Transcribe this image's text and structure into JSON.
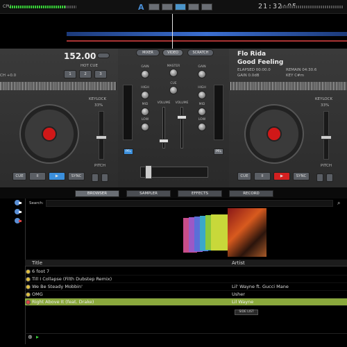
{
  "topbar": {
    "cpu_label": "CPU",
    "clock": "21:32:05",
    "logo": "A"
  },
  "deck_left": {
    "bpm": "152.00",
    "hot_cue_label": "HOT CUE",
    "hot_cues": [
      "1",
      "2",
      "3"
    ],
    "pitch_info": "CH +0.0",
    "keylock_label": "KEYLOCK",
    "pitch_pct": "33%",
    "pitch_label": "PITCH",
    "transport": [
      "CUE",
      "II",
      "▶",
      "SYNC"
    ]
  },
  "deck_right": {
    "artist": "Flo Rida",
    "title": "Good Feeling",
    "elapsed": "ELAPSED 00:00.0",
    "remain": "REMAIN 04:30.6",
    "gain": "GAIN 0.0dB",
    "key": "KEY C#m",
    "keylock_label": "KEYLOCK",
    "pitch_pct": "33%",
    "pitch_label": "PITCH",
    "transport": [
      "CUE",
      "II",
      "▶",
      "SYNC"
    ]
  },
  "mixer": {
    "tabs": [
      "MIXER",
      "VIDEO",
      "SCRATCH"
    ],
    "gain": "GAIN",
    "master": "MASTER",
    "high": "HIGH",
    "mid": "MID",
    "low": "LOW",
    "cue": "CUE",
    "volume": "VOLUME",
    "pfl": "PFL"
  },
  "bottom_tabs": [
    "BROWSER",
    "SAMPLER",
    "EFFECTS",
    "RECORD"
  ],
  "browser": {
    "search_label": "Search:",
    "columns": {
      "title": "Title",
      "artist": "Artist"
    },
    "rows": [
      {
        "title": "6 foot 7",
        "artist": ""
      },
      {
        "title": "Till I Collapse (Filth Dubstep Remix)",
        "artist": ""
      },
      {
        "title": "We Be Steady Mobbin'",
        "artist": "Lil' Wayne ft. Gucci Mane"
      },
      {
        "title": "OMG",
        "artist": "Usher"
      },
      {
        "title": "Right Above It (feat. Drake)",
        "artist": "Lil Wayne"
      }
    ],
    "side_list": "SIDE LIST"
  },
  "colors": {
    "accent_blue": "#3b8fdc",
    "platter_red": "#d01818",
    "selected_row": "#8aa83c"
  }
}
